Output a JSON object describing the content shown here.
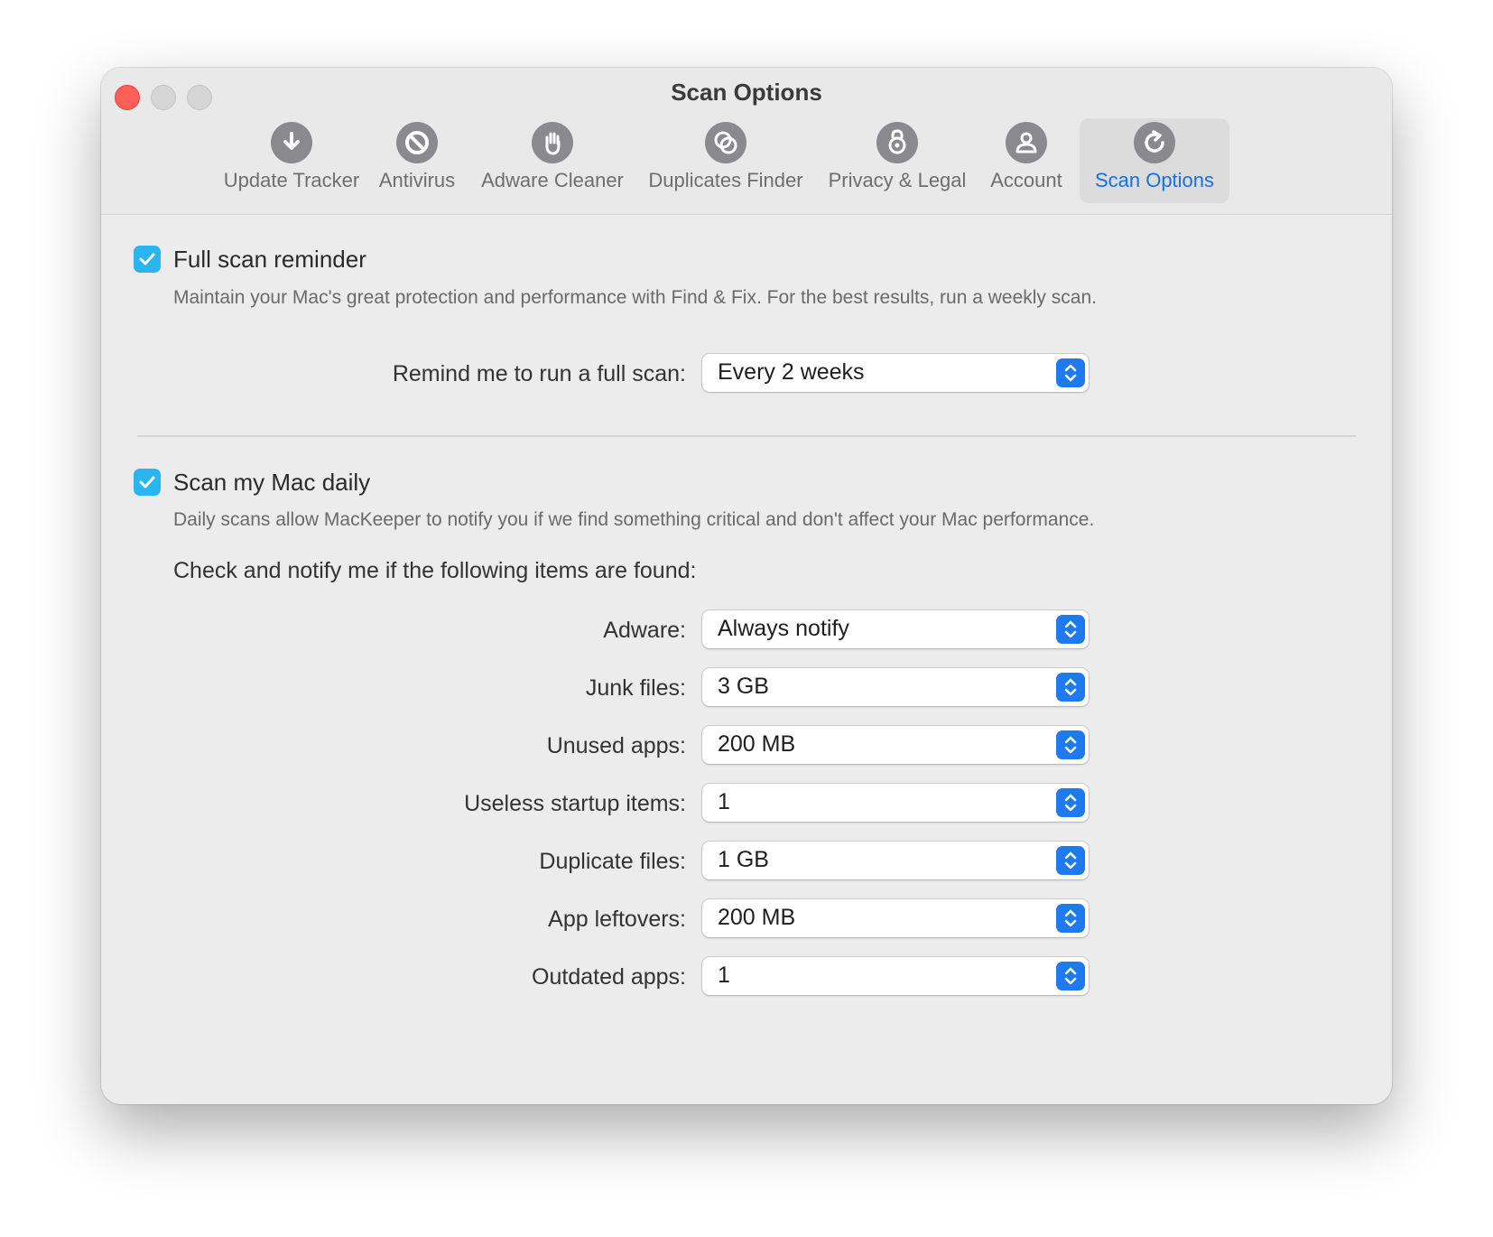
{
  "window": {
    "title": "Scan Options"
  },
  "toolbar": {
    "items": [
      {
        "label": "Update Tracker",
        "icon": "download-arrow-icon"
      },
      {
        "label": "Antivirus",
        "icon": "prohibited-icon"
      },
      {
        "label": "Adware Cleaner",
        "icon": "hand-icon"
      },
      {
        "label": "Duplicates Finder",
        "icon": "duplicate-circles-icon"
      },
      {
        "label": "Privacy & Legal",
        "icon": "lock-icon"
      },
      {
        "label": "Account",
        "icon": "user-icon"
      },
      {
        "label": "Scan Options",
        "icon": "refresh-icon",
        "selected": true
      }
    ]
  },
  "full_scan": {
    "checked": true,
    "title": "Full scan reminder",
    "description": "Maintain your Mac's great protection and performance with Find & Fix. For the best results, run a weekly scan.",
    "remind_label": "Remind me to run a full scan:",
    "remind_value": "Every 2 weeks"
  },
  "daily_scan": {
    "checked": true,
    "title": "Scan my Mac daily",
    "description": "Daily scans allow MacKeeper to notify you if we find something critical and don't affect your Mac performance.",
    "subhead": "Check and notify me if the following items are found:",
    "rows": [
      {
        "label": "Adware:",
        "value": "Always notify"
      },
      {
        "label": "Junk files:",
        "value": "3 GB"
      },
      {
        "label": "Unused apps:",
        "value": "200 MB"
      },
      {
        "label": "Useless startup items:",
        "value": "1"
      },
      {
        "label": "Duplicate files:",
        "value": "1 GB"
      },
      {
        "label": "App leftovers:",
        "value": "200 MB"
      },
      {
        "label": "Outdated apps:",
        "value": "1"
      }
    ]
  },
  "colors": {
    "accent": "#1f7af0",
    "checkbox": "#29b6f0",
    "close": "#ff5f57"
  }
}
